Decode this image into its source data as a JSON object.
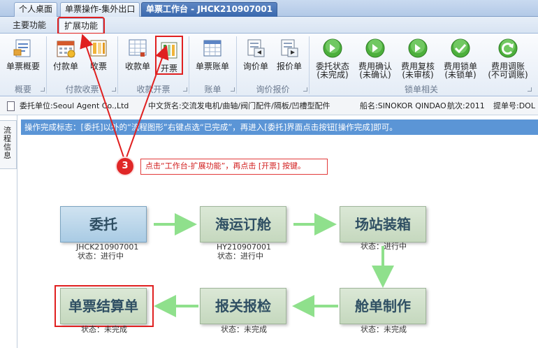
{
  "top_tabs": [
    "个人桌面",
    "单票操作-集外出口",
    "单票工作台 - JHCK210907001"
  ],
  "ribbon_tabs": [
    "主要功能",
    "扩展功能"
  ],
  "ribbon_buttons": {
    "dan_piao_gai_yao": "单票概要",
    "fu_kuan_dan": "付款单",
    "shou_piao": "收票",
    "shou_kuan_dan": "收款单",
    "kai_piao": "开票",
    "dan_piao_zhang_dan": "单票账单",
    "xun_jia_dan": "询价单",
    "bao_jia_dan": "报价单",
    "wei_tuo_zhuang_tai": [
      "委托状态",
      "(未完成)"
    ],
    "fei_yong_que_ren": [
      "费用确认",
      "(未确认)"
    ],
    "fei_yong_fu_he": [
      "费用复核",
      "(未审核)"
    ],
    "fei_yong_suo_dan": [
      "费用锁单",
      "(未锁单)"
    ],
    "fei_yong_tiao_zhang": [
      "费用调账",
      "(不可调账)"
    ]
  },
  "ribbon_groups": [
    "概要",
    "付款收票",
    "收款开票",
    "账单",
    "询价报价",
    "锁单相关"
  ],
  "info_bar": {
    "client": "委托单位:Seoul Agent Co.,Ltd",
    "goods": "中文货名:交流发电机/曲轴/阀门配件/隔板/凹槽型配件",
    "vessel": "船名:SINOKOR QINDAO",
    "voyage": "航次:2011",
    "bl": "提单号:DOL"
  },
  "side_tab": "流程信息",
  "notice": "操作完成标志：[委托]以外的“流程图形”右键点选“已完成”，再进入[委托]界面点击按钮[操作完成]即可。",
  "callout": {
    "step": "3",
    "text": "点击“工作台-扩展功能”，再点击 [开票] 按键。"
  },
  "flow": {
    "wei_tuo": {
      "label": "委托",
      "id": "JHCK210907001",
      "status": "状态：进行中"
    },
    "hai_yun": {
      "label": "海运订舱",
      "id": "HY210907001",
      "status": "状态：进行中"
    },
    "chang_zhan": {
      "label": "场站装箱",
      "status": "状态：进行中"
    },
    "cang_dan": {
      "label": "舱单制作",
      "status": "状态：未完成"
    },
    "bao_guan": {
      "label": "报关报检",
      "status": "状态：未完成"
    },
    "jie_suan": {
      "label": "单票结算单",
      "status": "状态：未完成"
    }
  },
  "colors": {
    "accent_red": "#e02020",
    "notice_blue": "#5b95d6",
    "arrow_green": "#8fe08c"
  }
}
